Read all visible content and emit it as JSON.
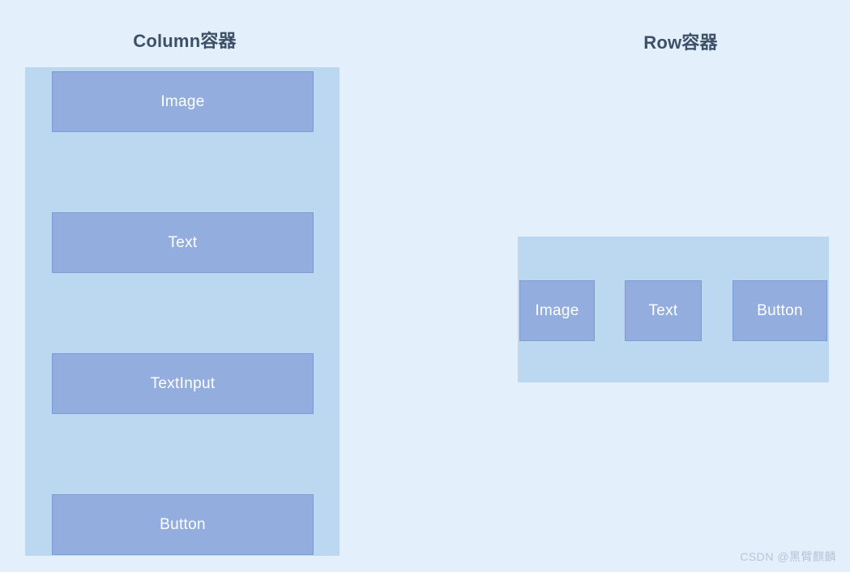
{
  "page": {
    "background_color": "#e4effc"
  },
  "colors": {
    "page_background": "#e4effc",
    "container_fill": "#bcd8f0",
    "child_fill": "#93aede",
    "child_border": "#7b9bd4",
    "title_text": "#3d5068",
    "child_label_text": "#ffffff",
    "watermark_text": "#b6c4d6"
  },
  "column_panel": {
    "title": "Column容器",
    "children": [
      {
        "label": "Image"
      },
      {
        "label": "Text"
      },
      {
        "label": "TextInput"
      },
      {
        "label": "Button"
      }
    ]
  },
  "row_panel": {
    "title": "Row容器",
    "children": [
      {
        "label": "Image"
      },
      {
        "label": "Text"
      },
      {
        "label": "Button"
      }
    ]
  },
  "watermark": {
    "text": "CSDN @黑臂麒麟"
  }
}
